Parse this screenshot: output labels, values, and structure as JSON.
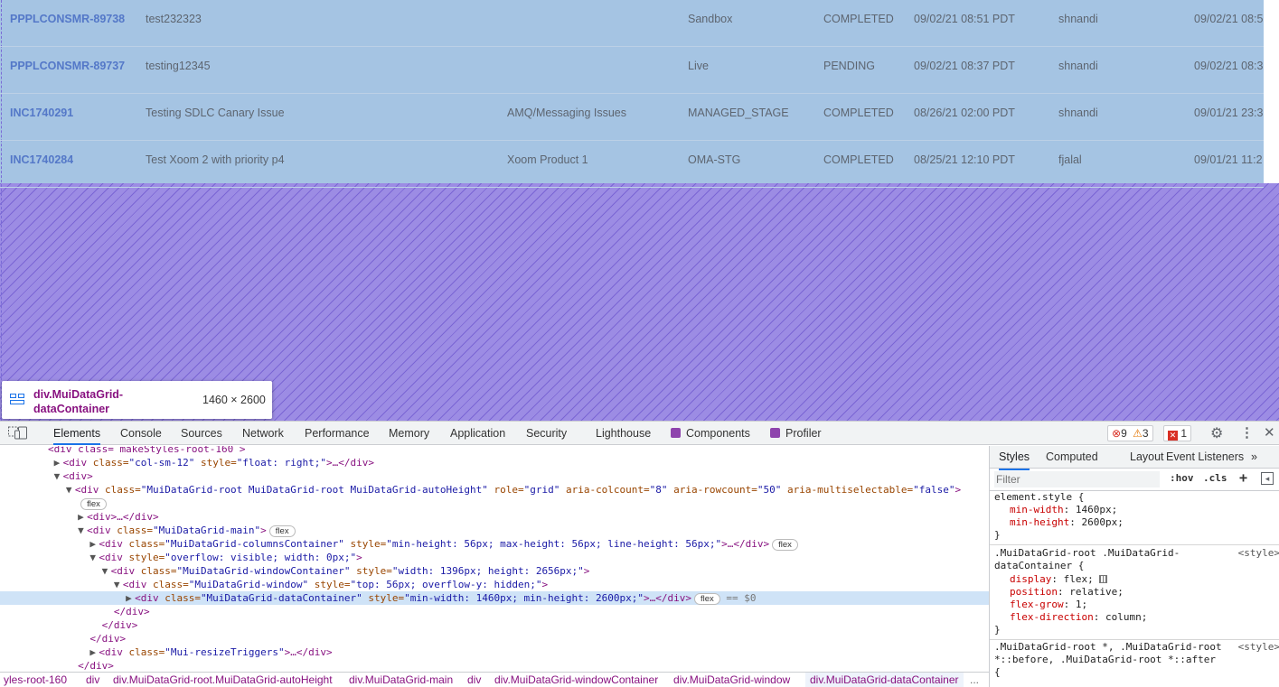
{
  "grid": {
    "rows": [
      {
        "id": "PPPLCONSMR-89738",
        "title": "test232323",
        "category": "",
        "env": "Sandbox",
        "status": "COMPLETED",
        "created": "09/02/21 08:51 PDT",
        "owner": "shnandi",
        "updated": "09/02/21 08:5"
      },
      {
        "id": "PPPLCONSMR-89737",
        "title": "testing12345",
        "category": "",
        "env": "Live",
        "status": "PENDING",
        "created": "09/02/21 08:37 PDT",
        "owner": "shnandi",
        "updated": "09/02/21 08:3"
      },
      {
        "id": "INC1740291",
        "title": "Testing SDLC Canary Issue",
        "category": "AMQ/Messaging Issues",
        "env": "MANAGED_STAGE",
        "status": "COMPLETED",
        "created": "08/26/21 02:00 PDT",
        "owner": "shnandi",
        "updated": "09/01/21 23:3"
      },
      {
        "id": "INC1740284",
        "title": "Test Xoom 2 with priority p4",
        "category": "Xoom Product 1",
        "env": "OMA-STG",
        "status": "COMPLETED",
        "created": "08/25/21 12:10 PDT",
        "owner": "fjalal",
        "updated": "09/01/21 11:2"
      }
    ]
  },
  "tooltip": {
    "tag": "div",
    "cls": ".MuiDataGrid-dataContainer",
    "size": "1460 × 2600"
  },
  "devtools": {
    "tabs": [
      "Elements",
      "Console",
      "Sources",
      "Network",
      "Performance",
      "Memory",
      "Application",
      "Security",
      "Lighthouse",
      "Components",
      "Profiler"
    ],
    "errors": "9",
    "warnings": "3",
    "issues": "1",
    "tree": [
      {
        "indent": "        ",
        "html": "<div class= makeStyles-root-160 >"
      },
      {
        "indent": "         ",
        "tri": "▶",
        "html": "<div class=\"col-sm-12\" style=\"float: right;\">…</div>"
      },
      {
        "indent": "         ",
        "tri": "▼",
        "html": "<div>"
      },
      {
        "indent": "           ",
        "tri": "▼",
        "html": "<div class=\"MuiDataGrid-root MuiDataGrid-root MuiDataGrid-autoHeight\" role=\"grid\" aria-colcount=\"8\" aria-rowcount=\"50\" aria-multiselectable=\"false\">"
      },
      {
        "indent": "             ",
        "html": "",
        "pill": "flex"
      },
      {
        "indent": "             ",
        "tri": "▶",
        "html": "<div>…</div>"
      },
      {
        "indent": "             ",
        "tri": "▼",
        "html": "<div class=\"MuiDataGrid-main\">",
        "pill": "flex"
      },
      {
        "indent": "               ",
        "tri": "▶",
        "html": "<div class=\"MuiDataGrid-columnsContainer\" style=\"min-height: 56px; max-height: 56px; line-height: 56px;\">…</div>",
        "pill": "flex"
      },
      {
        "indent": "               ",
        "tri": "▼",
        "html": "<div style=\"overflow: visible; width: 0px;\">"
      },
      {
        "indent": "                 ",
        "tri": "▼",
        "html": "<div class=\"MuiDataGrid-windowContainer\" style=\"width: 1396px; height: 2656px;\">"
      },
      {
        "indent": "                   ",
        "tri": "▼",
        "html": "<div class=\"MuiDataGrid-window\" style=\"top: 56px; overflow-y: hidden;\">"
      },
      {
        "indent": "                     ",
        "tri": "▶",
        "html": "<div class=\"MuiDataGrid-dataContainer\" style=\"min-width: 1460px; min-height: 2600px;\">…</div>",
        "pill": "flex",
        "suffix": " == $0",
        "selected": true
      },
      {
        "indent": "                   ",
        "html": "</div>"
      },
      {
        "indent": "                 ",
        "html": "</div>"
      },
      {
        "indent": "               ",
        "html": "</div>"
      },
      {
        "indent": "               ",
        "tri": "▶",
        "html": "<div class=\"Mui-resizeTriggers\">…</div>"
      },
      {
        "indent": "             ",
        "html": "</div>"
      }
    ],
    "breadcrumbs": [
      "yles-root-160",
      "div",
      "div.MuiDataGrid-root.MuiDataGrid-autoHeight",
      "div.MuiDataGrid-main",
      "div",
      "div.MuiDataGrid-windowContainer",
      "div.MuiDataGrid-window",
      "div.MuiDataGrid-dataContainer"
    ],
    "breadcrumb_more": "...",
    "styles": {
      "tabs": [
        "Styles",
        "Computed",
        "Layout",
        "Event Listeners",
        "»"
      ],
      "filter_placeholder": "Filter",
      "hov": ":hov",
      "cls": ".cls",
      "element_style_selector": "element.style {",
      "element_style_props": [
        [
          "min-width",
          "1460px;"
        ],
        [
          "min-height",
          "2600px;"
        ]
      ],
      "rule2_selector_l1": ".MuiDataGrid-root .MuiDataGrid-",
      "rule2_selector_l2": "dataContainer {",
      "rule2_source": "<style>",
      "rule2_props": [
        [
          "display",
          "flex;"
        ],
        [
          "position",
          "relative;"
        ],
        [
          "flex-grow",
          "1;"
        ],
        [
          "flex-direction",
          "column;"
        ]
      ],
      "rule3_l1": ".MuiDataGrid-root *, .MuiDataGrid-root",
      "rule3_l2": "*::before, .MuiDataGrid-root *::after",
      "rule3_source": "<style>",
      "close_brace": "}",
      "open_brace": "{"
    }
  }
}
